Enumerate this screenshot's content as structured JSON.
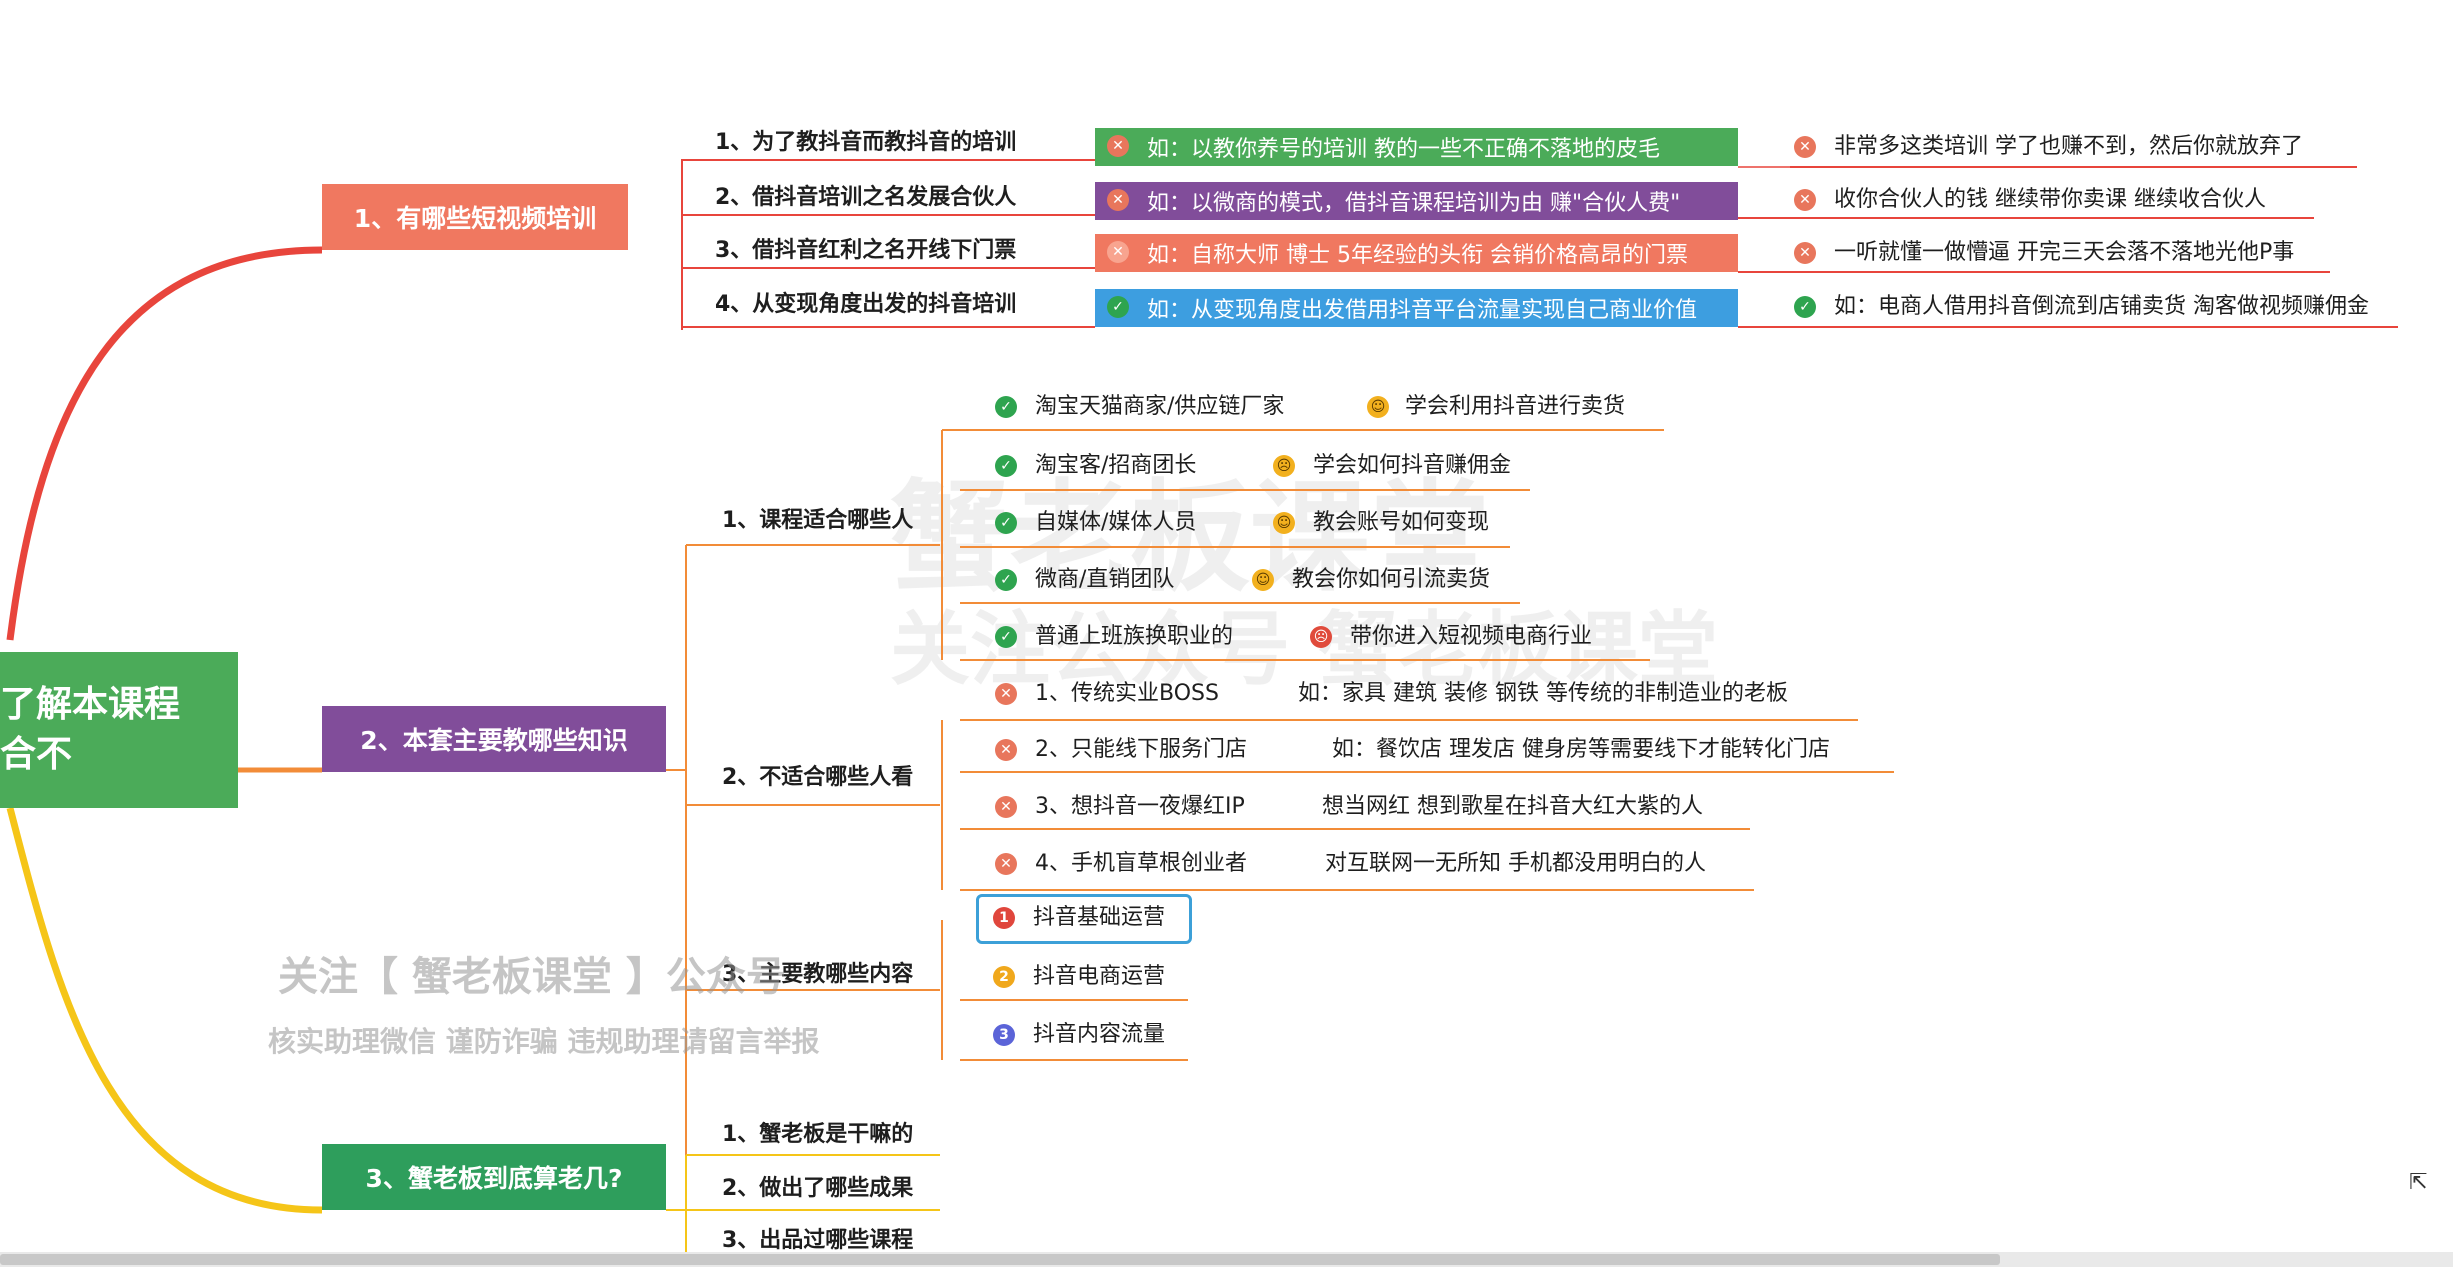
{
  "root": {
    "line1": "了解本课程",
    "line2": "合不"
  },
  "section1": {
    "title": "1、有哪些短视频培训",
    "items": [
      {
        "label": "1、为了教抖音而教抖音的培训",
        "detail": "如：以教你养号的培训  教的一些不正确不落地的皮毛",
        "note": "非常多这类培训  学了也赚不到，然后你就放弃了"
      },
      {
        "label": "2、借抖音培训之名发展合伙人",
        "detail": "如：以微商的模式，借抖音课程培训为由 赚\"合伙人费\"",
        "note": "收你合伙人的钱 继续带你卖课  继续收合伙人"
      },
      {
        "label": "3、借抖音红利之名开线下门票",
        "detail": "如：自称大师 博士  5年经验的头衔 会销价格高昂的门票",
        "note": "一听就懂一做懵逼   开完三天会落不落地光他P事"
      },
      {
        "label": "4、从变现角度出发的抖音培训",
        "detail": "如：从变现角度出发借用抖音平台流量实现自己商业价值",
        "note": "如：电商人借用抖音倒流到店铺卖货  淘客做视频赚佣金"
      }
    ]
  },
  "section2": {
    "title": "2、本套主要教哪些知识",
    "suitable": {
      "label": "1、课程适合哪些人",
      "items": [
        {
          "who": "淘宝天猫商家/供应链厂家",
          "what": "学会利用抖音进行卖货"
        },
        {
          "who": "淘宝客/招商团长",
          "what": "学会如何抖音赚佣金"
        },
        {
          "who": "自媒体/媒体人员",
          "what": "教会账号如何变现"
        },
        {
          "who": "微商/直销团队",
          "what": "教会你如何引流卖货"
        },
        {
          "who": "普通上班族换职业的",
          "what": "带你进入短视频电商行业"
        }
      ]
    },
    "unsuitable": {
      "label": "2、不适合哪些人看",
      "items": [
        {
          "who": "1、传统实业BOSS",
          "what": "如：家具  建筑  装修  钢铁  等传统的非制造业的老板"
        },
        {
          "who": "2、只能线下服务门店",
          "what": "如：餐饮店  理发店  健身房等需要线下才能转化门店"
        },
        {
          "who": "3、想抖音一夜爆红IP",
          "what": "想当网红  想到歌星在抖音大红大紫的人"
        },
        {
          "who": "4、手机盲草根创业者",
          "what": "对互联网一无所知  手机都没用明白的人"
        }
      ]
    },
    "content": {
      "label": "3、主要教哪些内容",
      "items": [
        {
          "num": "1",
          "text": "抖音基础运营"
        },
        {
          "num": "2",
          "text": "抖音电商运营"
        },
        {
          "num": "3",
          "text": "抖音内容流量"
        }
      ]
    }
  },
  "section3": {
    "title": "3、蟹老板到底算老几?",
    "items": [
      "1、蟹老板是干嘛的",
      "2、做出了哪些成果",
      "3、出品过哪些课程"
    ]
  },
  "watermark": {
    "line1": "关注【 蟹老板课堂 】公众号",
    "line2": "核实助理微信  谨防诈骗  违规助理请留言举报",
    "bg1": "蟹老板课堂",
    "bg2": "关注公众号 蟹老板课堂"
  },
  "colors": {
    "root": "#4bab59",
    "section1": "#f07860",
    "section2": "#814d9a",
    "section3": "#2e9e5c",
    "branch_orange": "#f28c38"
  },
  "icons": {
    "cross": "✕",
    "check": "✓",
    "emoji_smile": "☺",
    "emoji_meh": "☹"
  }
}
